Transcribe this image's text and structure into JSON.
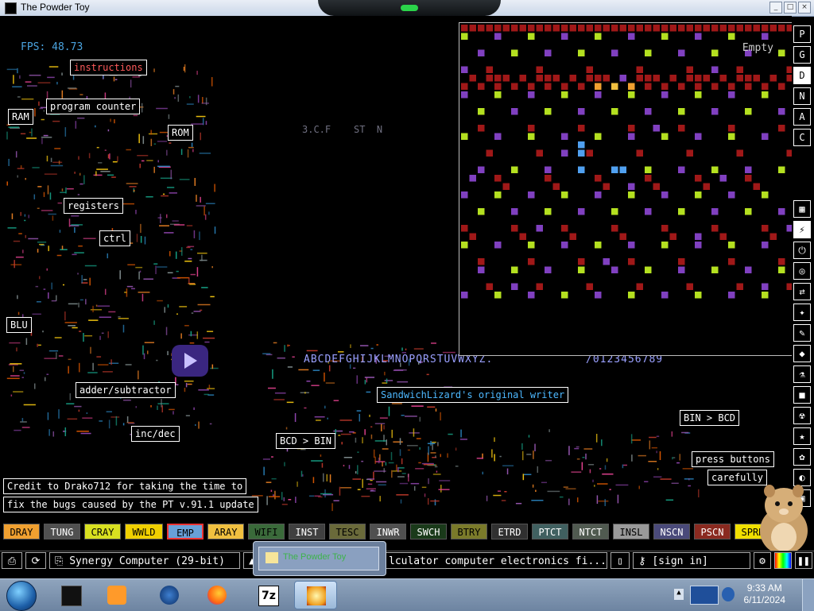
{
  "window": {
    "title": "The Powder Toy",
    "min": "_",
    "max": "□",
    "close": "×"
  },
  "game": {
    "fps": "FPS: 48.73",
    "labels": {
      "instructions": "instructions",
      "program_counter": "program counter",
      "ram": "RAM",
      "rom": "ROM",
      "registers": "registers",
      "ctrl": "ctrl",
      "blu": "BLU",
      "adder": "adder/subtractor",
      "incdec": "inc/dec",
      "credit1": "Credit to Drako712 for taking the time to",
      "credit2": "fix the bugs caused by the PT v.91.1 update",
      "writer": "SandwichLizard's original writer",
      "bcd_bin": "BCD > BIN",
      "bin_bcd": "BIN > BCD",
      "press1": "press buttons",
      "press2": "carefully",
      "alphabet": "ABCDEFGHIJKLMNOPQRSTUVWXYZ.",
      "digits": "/0123456789",
      "faint": "3.C.F    ST  N"
    },
    "zoom": {
      "status": "Empty"
    }
  },
  "sidebar": {
    "top": [
      "P",
      "G",
      "D",
      "N",
      "A",
      "C"
    ],
    "selected": "D"
  },
  "elements": [
    {
      "name": "DRAY",
      "bg": "#f0a030",
      "fg": "#000"
    },
    {
      "name": "TUNG",
      "bg": "#505050",
      "fg": "#fff"
    },
    {
      "name": "CRAY",
      "bg": "#d8e020",
      "fg": "#000"
    },
    {
      "name": "WWLD",
      "bg": "#f0d000",
      "fg": "#000"
    },
    {
      "name": "EMP",
      "bg": "#68a0d8",
      "fg": "#000"
    },
    {
      "name": "ARAY",
      "bg": "#f0c040",
      "fg": "#000"
    },
    {
      "name": "WIFI",
      "bg": "#3a6a3a",
      "fg": "#000"
    },
    {
      "name": "INST",
      "bg": "#404040",
      "fg": "#fff"
    },
    {
      "name": "TESC",
      "bg": "#6a6a3a",
      "fg": "#000"
    },
    {
      "name": "INWR",
      "bg": "#505050",
      "fg": "#fff"
    },
    {
      "name": "SWCH",
      "bg": "#1a3a1a",
      "fg": "#fff"
    },
    {
      "name": "BTRY",
      "bg": "#7a7a2a",
      "fg": "#000"
    },
    {
      "name": "ETRD",
      "bg": "#303030",
      "fg": "#fff"
    },
    {
      "name": "PTCT",
      "bg": "#406060",
      "fg": "#fff"
    },
    {
      "name": "NTCT",
      "bg": "#505a50",
      "fg": "#fff"
    },
    {
      "name": "INSL",
      "bg": "#9a9a9a",
      "fg": "#000"
    },
    {
      "name": "NSCN",
      "bg": "#4a4a7a",
      "fg": "#fff"
    },
    {
      "name": "PSCN",
      "bg": "#8a2a20",
      "fg": "#fff"
    },
    {
      "name": "SPRK",
      "bg": "#f0e000",
      "fg": "#000"
    }
  ],
  "bottom": {
    "save_name": "Synergy Computer (29-bit)",
    "tags": "lculator computer electronics fi...",
    "signin": "[sign in]"
  },
  "taskbar": {
    "popup": "The Powder Toy",
    "time": "9:33 AM",
    "date": "6/11/2024",
    "apps": [
      "monitor",
      "media-player",
      "globe",
      "firefox",
      "7z",
      "powder-toy"
    ]
  }
}
